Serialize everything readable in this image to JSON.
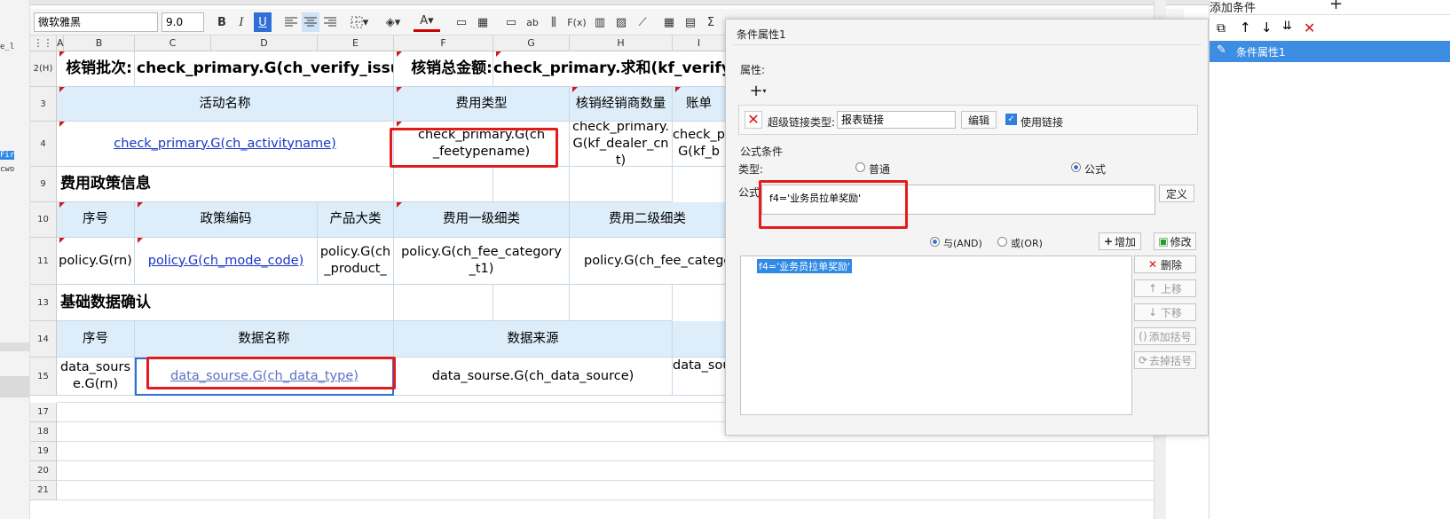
{
  "left_strip": [
    "e_l",
    "Fir",
    "cwo"
  ],
  "toolbar": {
    "font_name": "微软雅黑",
    "font_size": "9.0",
    "bold": "B",
    "italic": "I",
    "underline": "U",
    "sigma_label": "Σ"
  },
  "columns": [
    "A",
    "B",
    "C",
    "D",
    "E",
    "F",
    "G",
    "H",
    "I"
  ],
  "rows": {
    "r2": "2(H)",
    "r3": "3",
    "r4": "4",
    "r9": "9",
    "r10": "10",
    "r11": "11",
    "r13": "13",
    "r14": "14",
    "r15": "15",
    "r17": "17",
    "r18": "18",
    "r19": "19",
    "r20": "20",
    "r21": "21"
  },
  "cells": {
    "verify_batch_label": "核销批次:",
    "verify_batch_value": "check_primary.G(ch_verify_issue)",
    "verify_amount_label": "核销总金额:",
    "verify_amount_value": "check_primary.求和(kf_verify_am",
    "activity_name_hdr": "活动名称",
    "fee_type_hdr": "费用类型",
    "dealer_count_hdr": "核销经销商数量",
    "bill_hdr": "账单",
    "activity_name_val": "check_primary.G(ch_activityname)",
    "fee_type_val": "check_primary.G(ch_feetypename)",
    "dealer_cnt_val": "check_primary.G(kf_dealer_cnt)",
    "bill_val": "check_p G(kf_b",
    "policy_section": "费用政策信息",
    "seq_hdr": "序号",
    "policy_code_hdr": "政策编码",
    "product_hdr": "产品大类",
    "fee_cat1_hdr": "费用一级细类",
    "fee_cat2_hdr": "费用二级细类",
    "policy_rn": "policy.G(rn)",
    "policy_mode_code": "policy.G(ch_mode_code)",
    "policy_product": "policy.G(ch_product_",
    "policy_fee_cat1": "policy.G(ch_fee_category_t1)",
    "policy_fee_cat2": "policy.G(ch_fee_catego",
    "basic_section": "基础数据确认",
    "seq_hdr2": "序号",
    "data_name_hdr": "数据名称",
    "data_source_hdr": "数据来源",
    "data_rn": "data_sourse.G(rn)",
    "data_type": "data_sourse.G(ch_data_type)",
    "data_source_val": "data_sourse.G(ch_data_source)",
    "data_so_trunc": "data_sou"
  },
  "dialog": {
    "title": "条件属性1",
    "attr_label": "属性:",
    "add_symbol": "+",
    "hyperlink_type_label": "超级链接类型:",
    "hyperlink_type_value": "报表链接",
    "edit_button": "编辑",
    "use_link_label": "使用链接",
    "formula_condition_label": "公式条件",
    "type_label": "类型:",
    "normal_label": "普通",
    "formula_radio_label": "公式",
    "formula_label": "公式:",
    "formula_value": "f4='业务员拉单奖励'",
    "define_button": "定义",
    "and_label": "与(AND)",
    "or_label": "或(OR)",
    "add_button": "增加",
    "modify_button": "修改",
    "condition_item": "f4='业务员拉单奖励'",
    "delete_button": "删除",
    "move_up_button": "上移",
    "move_down_button": "下移",
    "add_bracket_button": "添加括号",
    "remove_bracket_button": "去掉括号"
  },
  "right_panel": {
    "title": "添加条件",
    "add_symbol": "+",
    "item_label": "条件属性1"
  },
  "colors": {
    "header_fill": "#ddeefa",
    "link": "#1a35c8",
    "highlight": "#e31b1b",
    "selection": "#2f8ae5"
  }
}
